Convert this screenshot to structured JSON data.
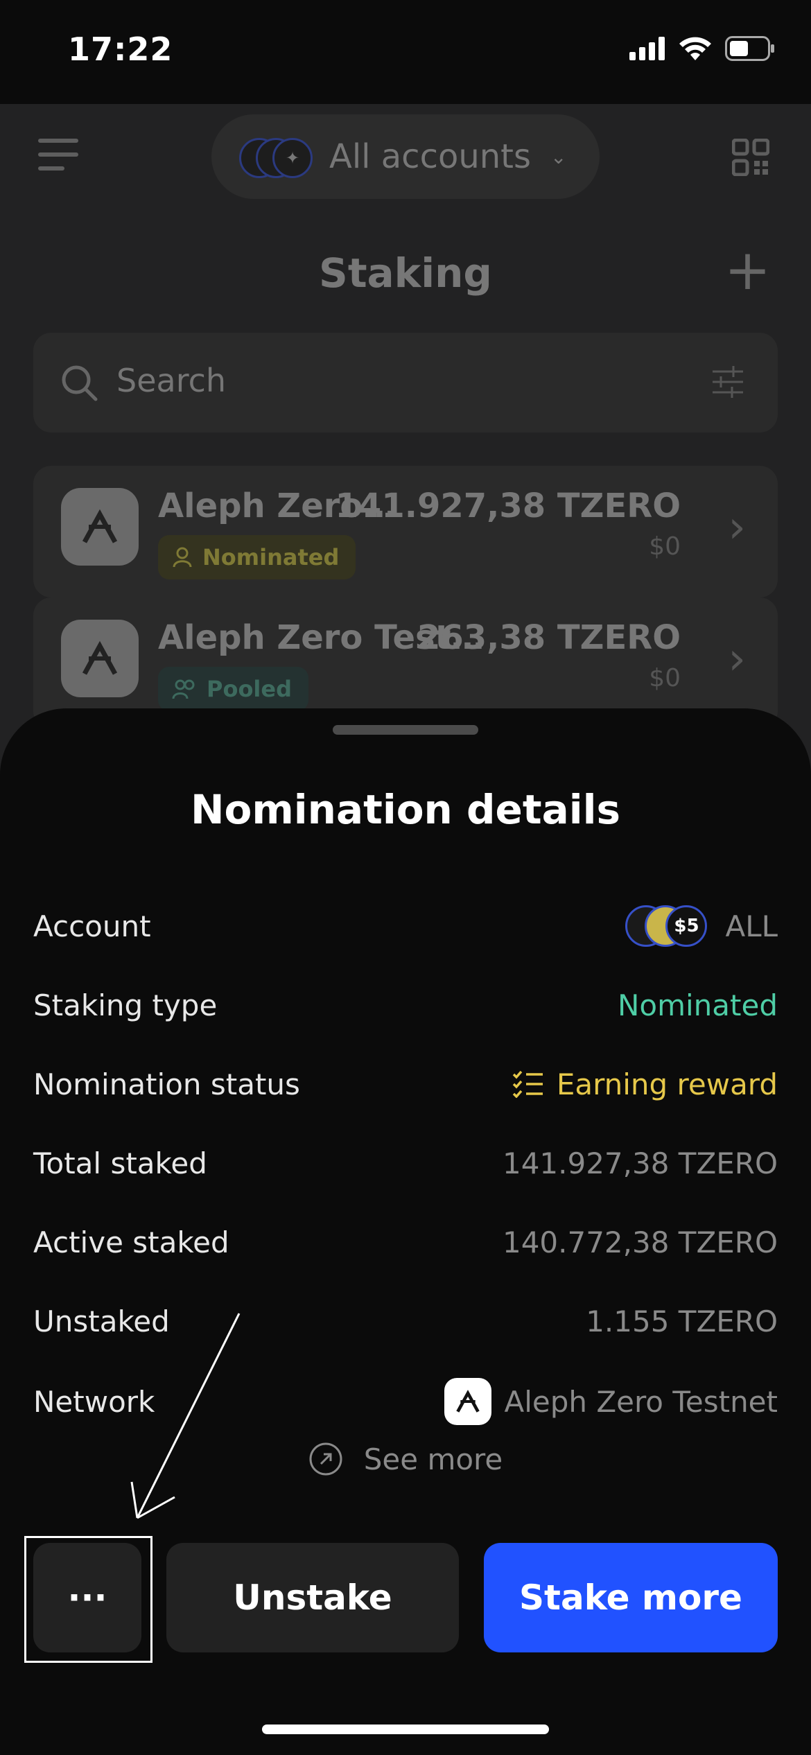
{
  "status_bar": {
    "time": "17:22"
  },
  "header": {
    "account_selector": "All accounts",
    "title": "Staking"
  },
  "search": {
    "placeholder": "Search"
  },
  "staking_list": [
    {
      "name": "Aleph Zero…",
      "badge": "Nominated",
      "amount": "141.927,38 TZERO",
      "usd": "$0"
    },
    {
      "name": "Aleph Zero Test…",
      "badge": "Pooled",
      "amount": "263,38 TZERO",
      "usd": "$0"
    }
  ],
  "sheet": {
    "title": "Nomination details",
    "rows": [
      {
        "label": "Account",
        "value": "ALL"
      },
      {
        "label": "Staking type",
        "value": "Nominated"
      },
      {
        "label": "Nomination status",
        "value": "Earning reward"
      },
      {
        "label": "Total staked",
        "value": "141.927,38 TZERO"
      },
      {
        "label": "Active staked",
        "value": "140.772,38 TZERO"
      },
      {
        "label": "Unstaked",
        "value": "1.155 TZERO"
      },
      {
        "label": "Network",
        "value": "Aleph Zero Testnet"
      }
    ],
    "see_more": "See more",
    "actions": {
      "more": "···",
      "unstake": "Unstake",
      "stake_more": "Stake more"
    }
  },
  "colors": {
    "accent": "#2152ff",
    "nominated_green": "#4fcea6",
    "earning_yellow": "#e6c84a"
  },
  "icons": [
    "menu-icon",
    "qr-code-icon",
    "plus-icon",
    "search-icon",
    "filter-icon",
    "chevron-right-icon",
    "user-icon",
    "users-icon",
    "checklist-icon",
    "external-link-icon",
    "aleph-zero-logo"
  ]
}
